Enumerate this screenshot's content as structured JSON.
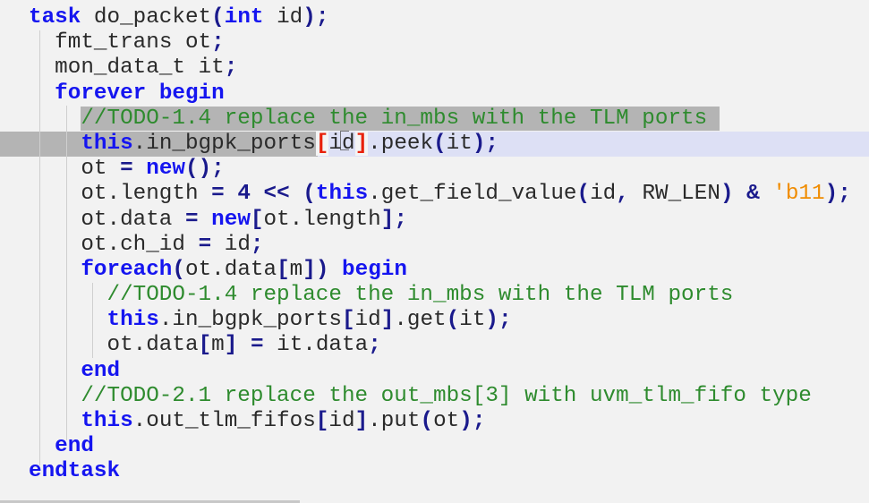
{
  "editor": {
    "language": "SystemVerilog",
    "colors": {
      "keyword": "#1515f0",
      "comment": "#2e8b2e",
      "literal": "#f08c00",
      "bracket_match": "#e8200a",
      "current_line": "#dde0f5",
      "selection": "#b4b4b4"
    },
    "lines": [
      [
        [
          "k",
          "task"
        ],
        [
          "i",
          " do_packet"
        ],
        [
          "p",
          "("
        ],
        [
          "k",
          "int"
        ],
        [
          "i",
          " id"
        ],
        [
          "p",
          ");"
        ]
      ],
      [
        [
          "w",
          "  "
        ],
        [
          "i",
          "fmt_trans ot"
        ],
        [
          "p",
          ";"
        ]
      ],
      [
        [
          "w",
          "  "
        ],
        [
          "i",
          "mon_data_t it"
        ],
        [
          "p",
          ";"
        ]
      ],
      [
        [
          "w",
          "  "
        ],
        [
          "k",
          "forever begin"
        ]
      ],
      [
        [
          "w",
          "    "
        ],
        [
          "cs",
          "//TODO-1.4 replace the in_mbs with the TLM ports"
        ]
      ],
      [
        [
          "w",
          "    "
        ],
        [
          "k",
          "this"
        ],
        [
          "i",
          ".in_bgpk_ports"
        ],
        [
          "b",
          "["
        ],
        [
          "i",
          "id"
        ],
        [
          "b",
          "]"
        ],
        [
          "i",
          ".peek"
        ],
        [
          "p",
          "("
        ],
        [
          "i",
          "it"
        ],
        [
          "p",
          ");"
        ]
      ],
      [
        [
          "w",
          "    "
        ],
        [
          "i",
          "ot "
        ],
        [
          "p",
          "="
        ],
        [
          "i",
          " "
        ],
        [
          "k",
          "new"
        ],
        [
          "p",
          "();"
        ]
      ],
      [
        [
          "w",
          "    "
        ],
        [
          "i",
          "ot.length "
        ],
        [
          "p",
          "="
        ],
        [
          "i",
          " "
        ],
        [
          "n",
          "4"
        ],
        [
          "i",
          " "
        ],
        [
          "p",
          "<<"
        ],
        [
          "i",
          " "
        ],
        [
          "p",
          "("
        ],
        [
          "k",
          "this"
        ],
        [
          "i",
          ".get_field_value"
        ],
        [
          "p",
          "("
        ],
        [
          "i",
          "id"
        ],
        [
          "p",
          ","
        ],
        [
          "i",
          " RW_LEN"
        ],
        [
          "p",
          ")"
        ],
        [
          "i",
          " "
        ],
        [
          "p",
          "&"
        ],
        [
          "i",
          " "
        ],
        [
          "s",
          "'b11"
        ],
        [
          "p",
          ");"
        ]
      ],
      [
        [
          "w",
          "    "
        ],
        [
          "i",
          "ot.data "
        ],
        [
          "p",
          "="
        ],
        [
          "i",
          " "
        ],
        [
          "k",
          "new"
        ],
        [
          "p",
          "["
        ],
        [
          "i",
          "ot.length"
        ],
        [
          "p",
          "];"
        ]
      ],
      [
        [
          "w",
          "    "
        ],
        [
          "i",
          "ot.ch_id "
        ],
        [
          "p",
          "="
        ],
        [
          "i",
          " id"
        ],
        [
          "p",
          ";"
        ]
      ],
      [
        [
          "w",
          "    "
        ],
        [
          "k",
          "foreach"
        ],
        [
          "p",
          "("
        ],
        [
          "i",
          "ot.data"
        ],
        [
          "p",
          "["
        ],
        [
          "i",
          "m"
        ],
        [
          "p",
          "])"
        ],
        [
          "i",
          " "
        ],
        [
          "k",
          "begin"
        ]
      ],
      [
        [
          "w",
          "      "
        ],
        [
          "c",
          "//TODO-1.4 replace the in_mbs with the TLM ports"
        ]
      ],
      [
        [
          "w",
          "      "
        ],
        [
          "k",
          "this"
        ],
        [
          "i",
          ".in_bgpk_ports"
        ],
        [
          "p",
          "["
        ],
        [
          "i",
          "id"
        ],
        [
          "p",
          "]"
        ],
        [
          "i",
          ".get"
        ],
        [
          "p",
          "("
        ],
        [
          "i",
          "it"
        ],
        [
          "p",
          ");"
        ]
      ],
      [
        [
          "w",
          "      "
        ],
        [
          "i",
          "ot.data"
        ],
        [
          "p",
          "["
        ],
        [
          "i",
          "m"
        ],
        [
          "p",
          "]"
        ],
        [
          "i",
          " "
        ],
        [
          "p",
          "="
        ],
        [
          "i",
          " it.data"
        ],
        [
          "p",
          ";"
        ]
      ],
      [
        [
          "w",
          "    "
        ],
        [
          "k",
          "end"
        ]
      ],
      [
        [
          "w",
          "    "
        ],
        [
          "c",
          "//TODO-2.1 replace the out_mbs[3] with uvm_tlm_fifo type"
        ]
      ],
      [
        [
          "w",
          "    "
        ],
        [
          "k",
          "this"
        ],
        [
          "i",
          ".out_tlm_fifos"
        ],
        [
          "p",
          "["
        ],
        [
          "i",
          "id"
        ],
        [
          "p",
          "]"
        ],
        [
          "i",
          ".put"
        ],
        [
          "p",
          "("
        ],
        [
          "i",
          "ot"
        ],
        [
          "p",
          ");"
        ]
      ],
      [
        [
          "w",
          "  "
        ],
        [
          "k",
          "end"
        ]
      ],
      [
        [
          "k",
          "endtask"
        ]
      ]
    ],
    "current_line_index": 5
  }
}
